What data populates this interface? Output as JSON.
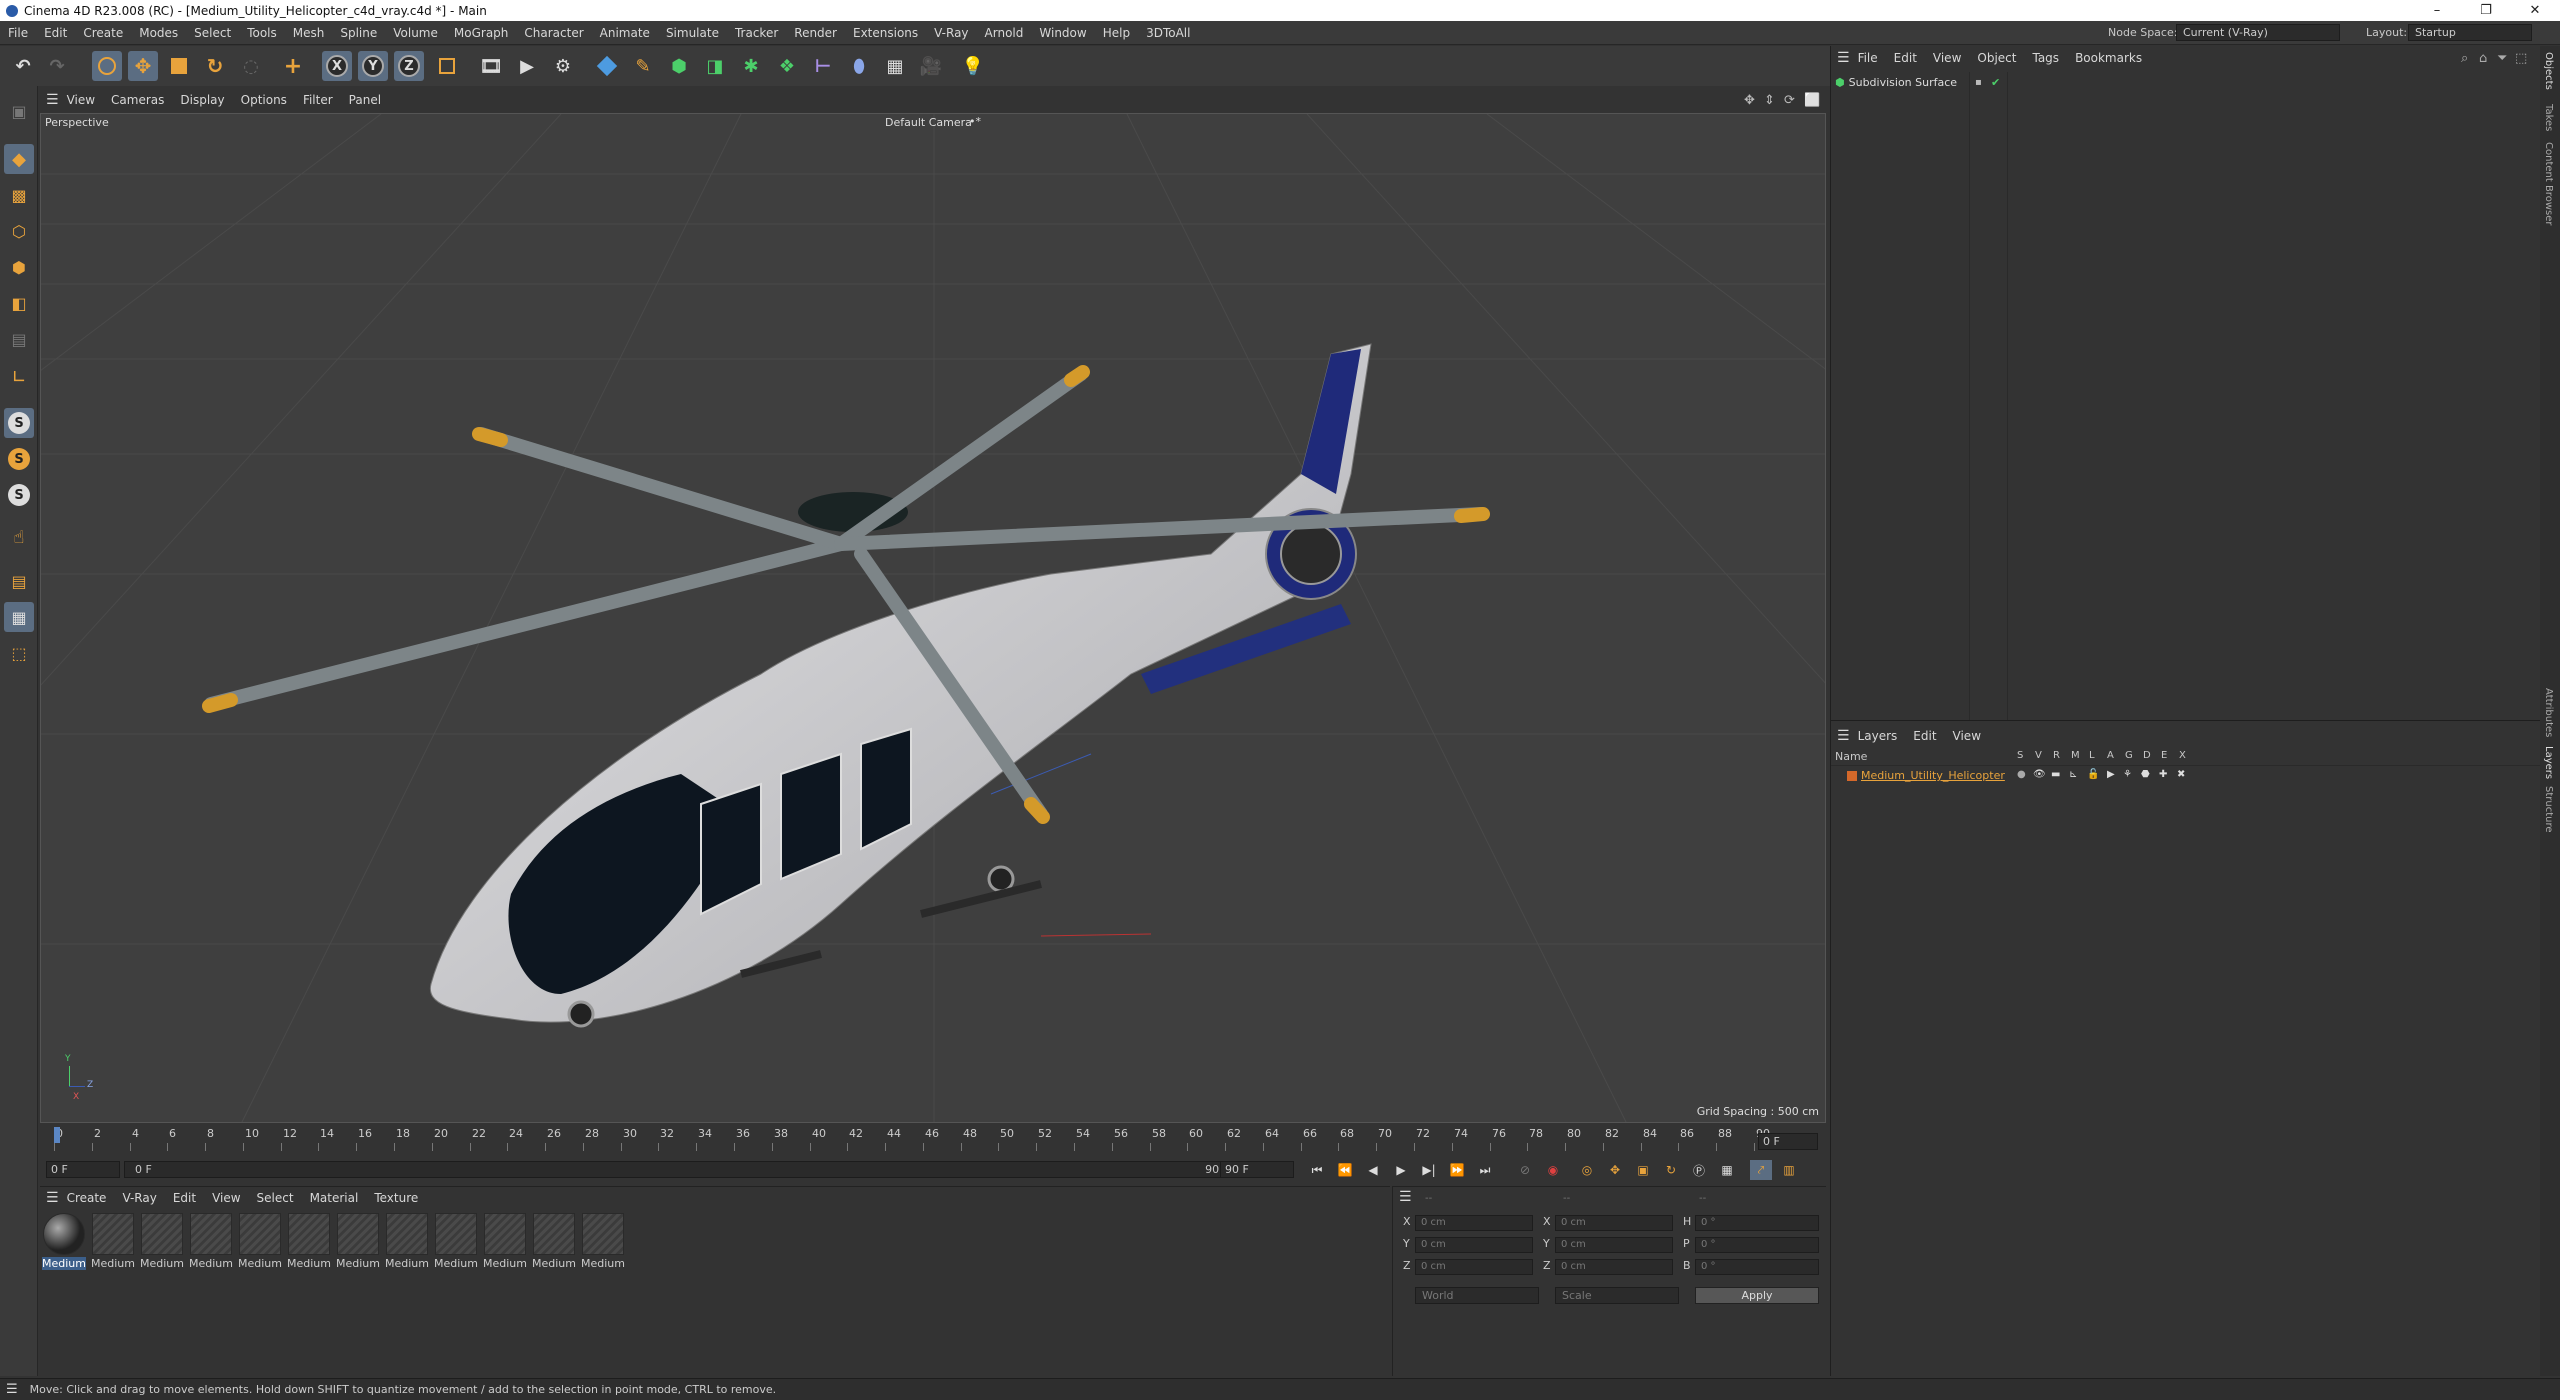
{
  "window": {
    "title": "Cinema 4D R23.008 (RC) - [Medium_Utility_Helicopter_c4d_vray.c4d *] - Main",
    "controls": [
      "–",
      "❐",
      "✕"
    ]
  },
  "menubar": {
    "items": [
      "File",
      "Edit",
      "Create",
      "Modes",
      "Select",
      "Tools",
      "Mesh",
      "Spline",
      "Volume",
      "MoGraph",
      "Character",
      "Animate",
      "Simulate",
      "Tracker",
      "Render",
      "Extensions",
      "V-Ray",
      "Arnold",
      "Window",
      "Help",
      "3DToAll"
    ],
    "node_space_label": "Node Space:",
    "node_space_value": "Current (V-Ray)",
    "layout_label": "Layout:",
    "layout_value": "Startup"
  },
  "toolbar": {
    "axis_x": "X",
    "axis_y": "Y",
    "axis_z": "Z"
  },
  "lefttools": {
    "s_label": "S"
  },
  "viewport": {
    "menu": [
      "View",
      "Cameras",
      "Display",
      "Options",
      "Filter",
      "Panel"
    ],
    "view_name": "Perspective",
    "camera": "Default Camera",
    "camera_marker": "•*",
    "grid_spacing": "Grid Spacing : 500 cm",
    "axis_x": "X",
    "axis_y": "Y",
    "axis_z": "Z"
  },
  "timeline": {
    "ticks": [
      "0",
      "2",
      "4",
      "6",
      "8",
      "10",
      "12",
      "14",
      "16",
      "18",
      "20",
      "22",
      "24",
      "26",
      "28",
      "30",
      "32",
      "34",
      "36",
      "38",
      "40",
      "42",
      "44",
      "46",
      "48",
      "50",
      "52",
      "54",
      "56",
      "58",
      "60",
      "62",
      "64",
      "66",
      "68",
      "70",
      "72",
      "74",
      "76",
      "78",
      "80",
      "82",
      "84",
      "86",
      "88",
      "90"
    ],
    "current_frame": "0 F",
    "start_frame": "0 F",
    "range_start": "0 F",
    "range_end": "90 F",
    "end_frame": "90 F",
    "end_frame_right": "0 F"
  },
  "materials": {
    "menu": [
      "Create",
      "V-Ray",
      "Edit",
      "View",
      "Select",
      "Material",
      "Texture"
    ],
    "items": [
      "Medium",
      "Medium",
      "Medium",
      "Medium",
      "Medium",
      "Medium",
      "Medium",
      "Medium",
      "Medium",
      "Medium",
      "Medium",
      "Medium"
    ]
  },
  "coordinates": {
    "header_left": "--",
    "header_mid": "--",
    "header_right": "--",
    "rows": [
      {
        "a": "X",
        "av": "0 cm",
        "b": "X",
        "bv": "0 cm",
        "c": "H",
        "cv": "0 °"
      },
      {
        "a": "Y",
        "av": "0 cm",
        "b": "Y",
        "bv": "0 cm",
        "c": "P",
        "cv": "0 °"
      },
      {
        "a": "Z",
        "av": "0 cm",
        "b": "Z",
        "bv": "0 cm",
        "c": "B",
        "cv": "0 °"
      }
    ],
    "mode": "World",
    "scale": "Scale",
    "apply": "Apply"
  },
  "objects": {
    "menu": [
      "File",
      "Edit",
      "View",
      "Object",
      "Tags",
      "Bookmarks"
    ],
    "items": [
      {
        "name": "Subdivision Surface"
      }
    ]
  },
  "layers": {
    "menu": [
      "Layers",
      "Edit",
      "View"
    ],
    "col_name": "Name",
    "col_flags": [
      "S",
      "V",
      "R",
      "M",
      "L",
      "A",
      "G",
      "D",
      "E",
      "X"
    ],
    "items": [
      {
        "name": "Medium_Utility_Helicopter",
        "color": "#d4682a"
      }
    ]
  },
  "vertical_tabs": [
    "Objects",
    "Takes",
    "Content Browser",
    "Attributes",
    "Layers",
    "Structure"
  ],
  "status": {
    "text": "Move: Click and drag to move elements. Hold down SHIFT to quantize movement / add to the selection in point mode, CTRL to remove."
  },
  "colors": {
    "accent_orange": "#e8a33c",
    "selection_blue": "#5b6d82",
    "layer_orange": "#d4682a"
  }
}
